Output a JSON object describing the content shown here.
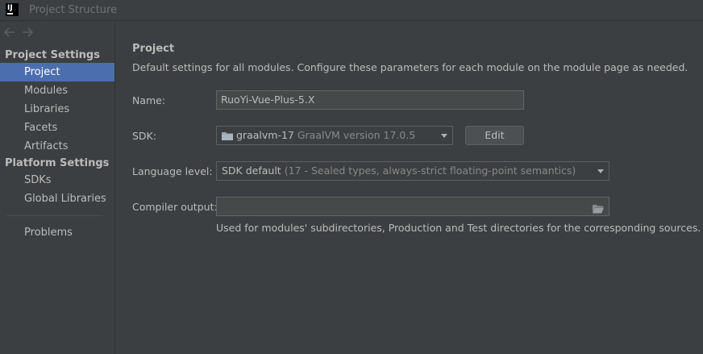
{
  "window": {
    "app_logo": "IJ",
    "title": "Project Structure"
  },
  "sidebar": {
    "back_icon": "arrow-left-icon",
    "forward_icon": "arrow-right-icon",
    "project_settings_header": "Project Settings",
    "project_settings_items": [
      {
        "label": "Project",
        "selected": true
      },
      {
        "label": "Modules",
        "selected": false
      },
      {
        "label": "Libraries",
        "selected": false
      },
      {
        "label": "Facets",
        "selected": false
      },
      {
        "label": "Artifacts",
        "selected": false
      }
    ],
    "platform_settings_header": "Platform Settings",
    "platform_settings_items": [
      {
        "label": "SDKs"
      },
      {
        "label": "Global Libraries"
      }
    ],
    "problems_label": "Problems"
  },
  "main": {
    "heading": "Project",
    "description": "Default settings for all modules. Configure these parameters for each module on the module page as needed.",
    "name": {
      "label": "Name:",
      "value": "RuoYi-Vue-Plus-5.X"
    },
    "sdk": {
      "label": "SDK:",
      "icon": "folder-icon",
      "selected_name": "graalvm-17",
      "selected_detail": "GraalVM version 17.0.5",
      "edit_label": "Edit"
    },
    "language_level": {
      "label": "Language level:",
      "selected_name": "SDK default",
      "selected_detail": "(17 - Sealed types, always-strict floating-point semantics)"
    },
    "compiler_output": {
      "label": "Compiler output:",
      "value": "",
      "browse_icon": "folder-browse-icon",
      "hint": "Used for modules' subdirectories, Production and Test directories for the corresponding sources."
    }
  },
  "colors": {
    "background": "#3c3f41",
    "selection": "#4b6eaf",
    "text": "#bbbbbb",
    "muted_text": "#888888",
    "field_background": "#45494a",
    "button_background": "#4c5052"
  }
}
